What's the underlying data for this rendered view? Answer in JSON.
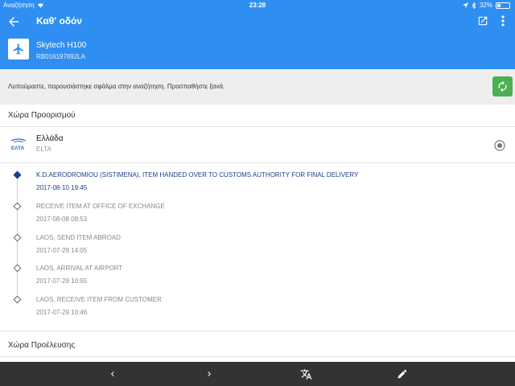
{
  "status_bar": {
    "carrier": "Αναζήτηση",
    "time": "23:28",
    "battery": "32%",
    "battery_level": 0.32
  },
  "header": {
    "title": "Καθ' οδόν",
    "package_name": "Skytech H100",
    "tracking_code": "RB016197892LA"
  },
  "error": {
    "message": "Λυπούμαστε, παρουσιάστηκε σφάλμα στην αναζήτηση. Προσπαθήστε ξανά."
  },
  "destination": {
    "section_title": "Χώρα Προορισμού",
    "country": "Ελλάδα",
    "carrier": "ELTA",
    "logo_text": "ΕΛΤΑ"
  },
  "events": [
    {
      "description": "K.D.AERODROMIOU (SISTIMENA), ITEM HANDED OVER TO CUSTOMS AUTHORITY FOR FINAL DELIVERY",
      "date": "2017-08-10 19:45"
    },
    {
      "description": "RECEIVE ITEM AT OFFICE OF EXCHANGE",
      "date": "2017-08-08 08:53"
    },
    {
      "description": "LAOS, SEND ITEM ABROAD",
      "date": "2017-07-29 14:05"
    },
    {
      "description": "LAOS, ARRIVAL AT AIRPORT",
      "date": "2017-07-29 10:55"
    },
    {
      "description": "LAOS, RECEIVE ITEM FROM CUSTOMER",
      "date": "2017-07-29 10:46"
    }
  ],
  "origin": {
    "section_title": "Χώρα Προέλευσης"
  },
  "colors": {
    "header": "#2f8ef2",
    "active_event": "#1a3f8f",
    "refresh": "#4caf50",
    "bottom_bar": "#333333"
  }
}
